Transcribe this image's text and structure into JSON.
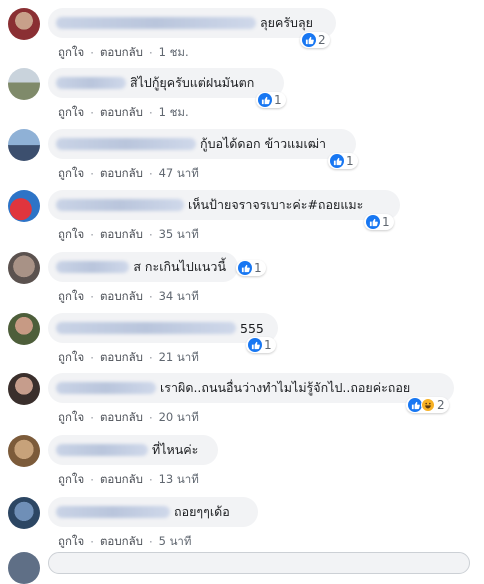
{
  "comments": [
    {
      "text": "ลุยครับลุย",
      "reactions": "2",
      "time": "1 ชม.",
      "like": "ถูกใจ",
      "reply": "ตอบกลับ"
    },
    {
      "text": "สิไปกู้ยุครับแต่ฝนมันตก",
      "reactions": "1",
      "time": "1 ชม.",
      "like": "ถูกใจ",
      "reply": "ตอบกลับ"
    },
    {
      "text": "กู้บอได้ดอก ข้าวแมเฒ่า",
      "reactions": "1",
      "time": "47 นาที",
      "like": "ถูกใจ",
      "reply": "ตอบกลับ"
    },
    {
      "text": "เห็นป้ายจราจรเบาะค่ะ#ถอยแมะ",
      "reactions": "1",
      "time": "35 นาที",
      "like": "ถูกใจ",
      "reply": "ตอบกลับ"
    },
    {
      "text": "ส กะเกินไปแนวนี้",
      "reactions": "1",
      "time": "34 นาที",
      "like": "ถูกใจ",
      "reply": "ตอบกลับ"
    },
    {
      "text": "555",
      "reactions": "1",
      "time": "21 นาที",
      "like": "ถูกใจ",
      "reply": "ตอบกลับ"
    },
    {
      "text": "เราผิด..ถนนอื่นว่างทำไมไม่รู้จักไป..ถอยค่ะถอย",
      "reactions": "2",
      "time": "20 นาที",
      "like": "ถูกใจ",
      "reply": "ตอบกลับ"
    },
    {
      "text": "ที่ไหนค่ะ",
      "reactions": "",
      "time": "13 นาที",
      "like": "ถูกใจ",
      "reply": "ตอบกลับ"
    },
    {
      "text": "ถอยๆๆเด้อ",
      "reactions": "",
      "time": "5 นาที",
      "like": "ถูกใจ",
      "reply": "ตอบกลับ"
    }
  ],
  "colors": {
    "like_blue": "#1877f2",
    "bubble_bg": "#f2f3f5",
    "meta_text": "#606770",
    "haha_yellow": "#f7b125"
  },
  "icons": {
    "like": "like-icon",
    "haha": "haha-icon"
  }
}
